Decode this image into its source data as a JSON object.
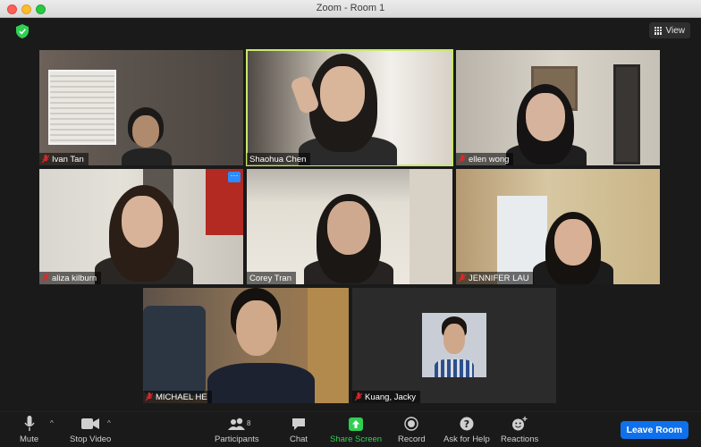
{
  "window": {
    "title": "Zoom - Room 1"
  },
  "header": {
    "view_label": "View"
  },
  "participants": [
    {
      "name": "Ivan Tan",
      "muted": true,
      "active_speaker": false
    },
    {
      "name": "Shaohua Chen",
      "muted": false,
      "active_speaker": true
    },
    {
      "name": "ellen wong",
      "muted": true,
      "active_speaker": false
    },
    {
      "name": "aliza kilburn",
      "muted": true,
      "active_speaker": false,
      "more_menu": "···"
    },
    {
      "name": "Corey Tran",
      "muted": false,
      "active_speaker": false
    },
    {
      "name": "JENNIFER LAU",
      "muted": true,
      "active_speaker": false
    },
    {
      "name": "MICHAEL HE",
      "muted": true,
      "active_speaker": false
    },
    {
      "name": "Kuang, Jacky",
      "muted": true,
      "active_speaker": false
    }
  ],
  "toolbar": {
    "mute": "Mute",
    "stop_video": "Stop Video",
    "participants": "Participants",
    "participants_count": "8",
    "chat": "Chat",
    "share_screen": "Share Screen",
    "record": "Record",
    "ask_for_help": "Ask for Help",
    "reactions": "Reactions",
    "leave_room": "Leave Room"
  },
  "colors": {
    "active_speaker_border": "#c7e86c",
    "share_green": "#2fd052",
    "leave_blue": "#0e71eb",
    "muted_red": "#e02828",
    "security_green": "#2fd052"
  },
  "icons": {
    "security": "shield-check-icon",
    "view": "grid-icon",
    "mute": "microphone-icon",
    "video": "video-camera-icon",
    "participants": "people-icon",
    "chat": "chat-bubble-icon",
    "share": "share-screen-icon",
    "record": "record-icon",
    "help": "question-icon",
    "reactions": "emoji-plus-icon"
  }
}
